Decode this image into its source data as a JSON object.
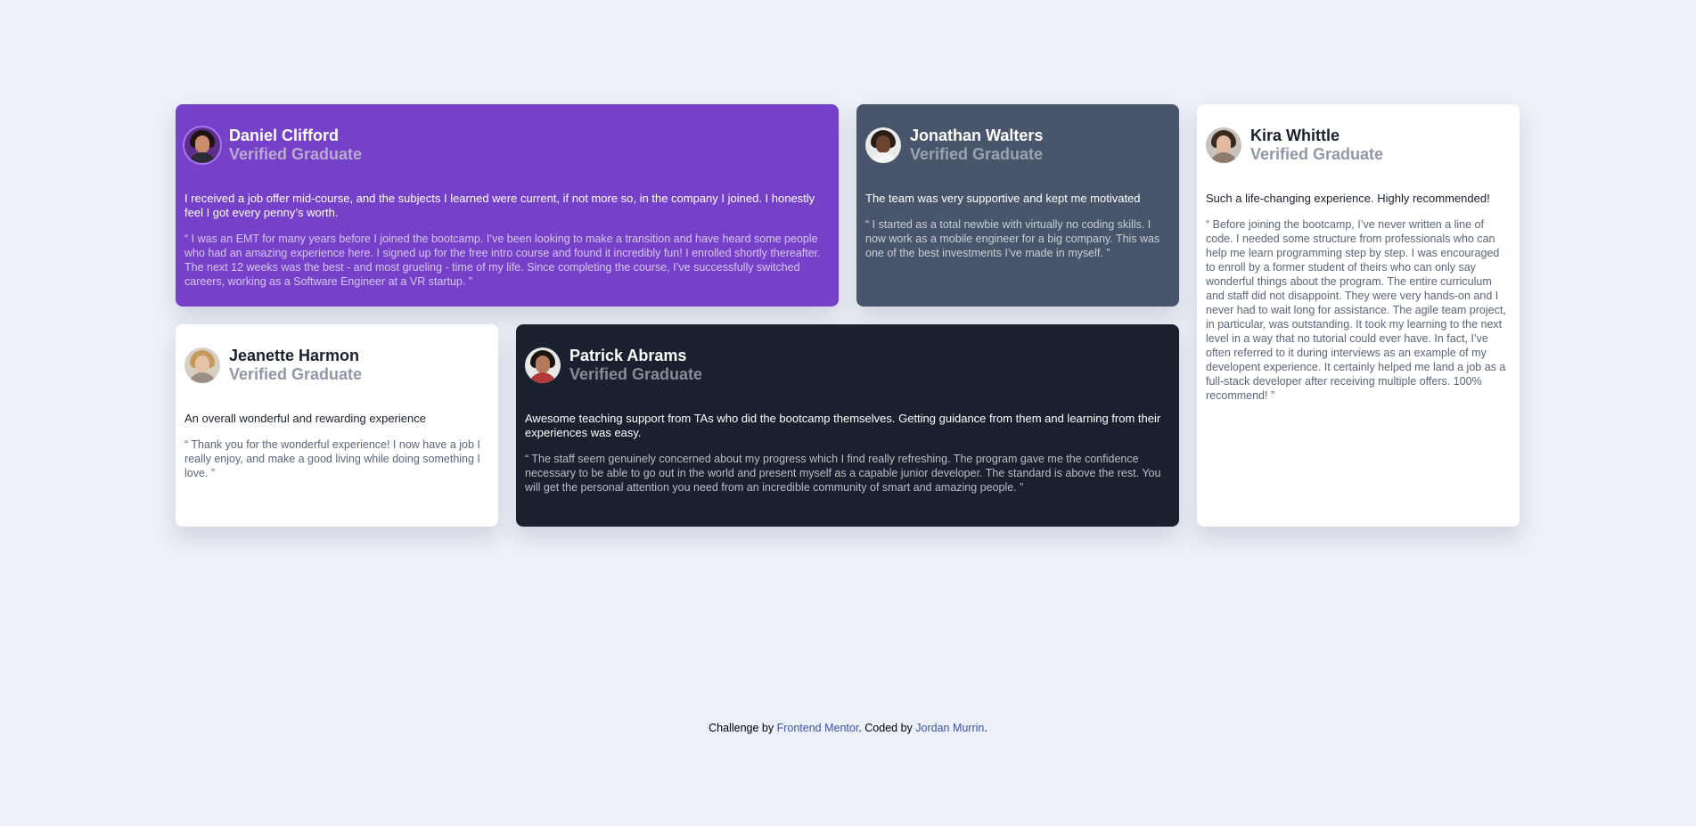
{
  "colors": {
    "background": "#ecf0f8",
    "card_purple": "#7541c8",
    "card_grayish_blue": "#48556a",
    "card_white": "#ffffff",
    "card_dark_blue": "#19212e",
    "link": "#3e52a3"
  },
  "testimonials": [
    {
      "name": "Daniel Clifford",
      "status": "Verified Graduate",
      "headline": "I received a job offer mid-course, and the subjects I learned were current, if not more so, in the company I joined. I honestly feel I got every penny’s worth.",
      "quote": "“ I was an EMT for many years before I joined the bootcamp. I’ve been looking to make a transition and have heard some people who had an amazing experience here. I signed up for the free intro course and found it incredibly fun! I enrolled shortly thereafter. The next 12 weeks was the best - and most grueling - time of my life. Since completing the course, I’ve successfully switched careers, working as a Software Engineer at a VR startup. ”"
    },
    {
      "name": "Jonathan Walters",
      "status": "Verified Graduate",
      "headline": "The team was very supportive and kept me motivated",
      "quote": "“ I started as a total newbie with virtually no coding skills. I now work as a mobile engineer for a big company. This was one of the best investments I’ve made in myself. ”"
    },
    {
      "name": "Kira Whittle",
      "status": "Verified Graduate",
      "headline": "Such a life-changing experience. Highly recommended!",
      "quote": "“ Before joining the bootcamp, I’ve never written a line of code. I needed some structure from professionals who can help me learn programming step by step. I was encouraged to enroll by a former student of theirs who can only say wonderful things about the program. The entire curriculum and staff did not disappoint. They were very hands-on and I never had to wait long for assistance. The agile team project, in particular, was outstanding. It took my learning to the next level in a way that no tutorial could ever have. In fact, I’ve often referred to it during interviews as an example of my developent experience. It certainly helped me land a job as a full-stack developer after receiving multiple offers. 100% recommend! ”"
    },
    {
      "name": "Jeanette Harmon",
      "status": "Verified Graduate",
      "headline": "An overall wonderful and rewarding experience",
      "quote": "“ Thank you for the wonderful experience! I now have a job I really enjoy, and make a good living while doing something I love. ”"
    },
    {
      "name": "Patrick Abrams",
      "status": "Verified Graduate",
      "headline": "Awesome teaching support from TAs who did the bootcamp themselves. Getting guidance from them and learning from their experiences was easy.",
      "quote": "“ The staff seem genuinely concerned about my progress which I find really refreshing. The program gave me the confidence necessary to be able to go out in the world and present myself as a capable junior developer. The standard is above the rest. You will get the personal attention you need from an incredible community of smart and amazing people. ”"
    }
  ],
  "footer": {
    "prefix": "Challenge by ",
    "link1": "Frontend Mentor",
    "middle": ". Coded by ",
    "link2": "Jordan Murrin",
    "suffix": "."
  }
}
